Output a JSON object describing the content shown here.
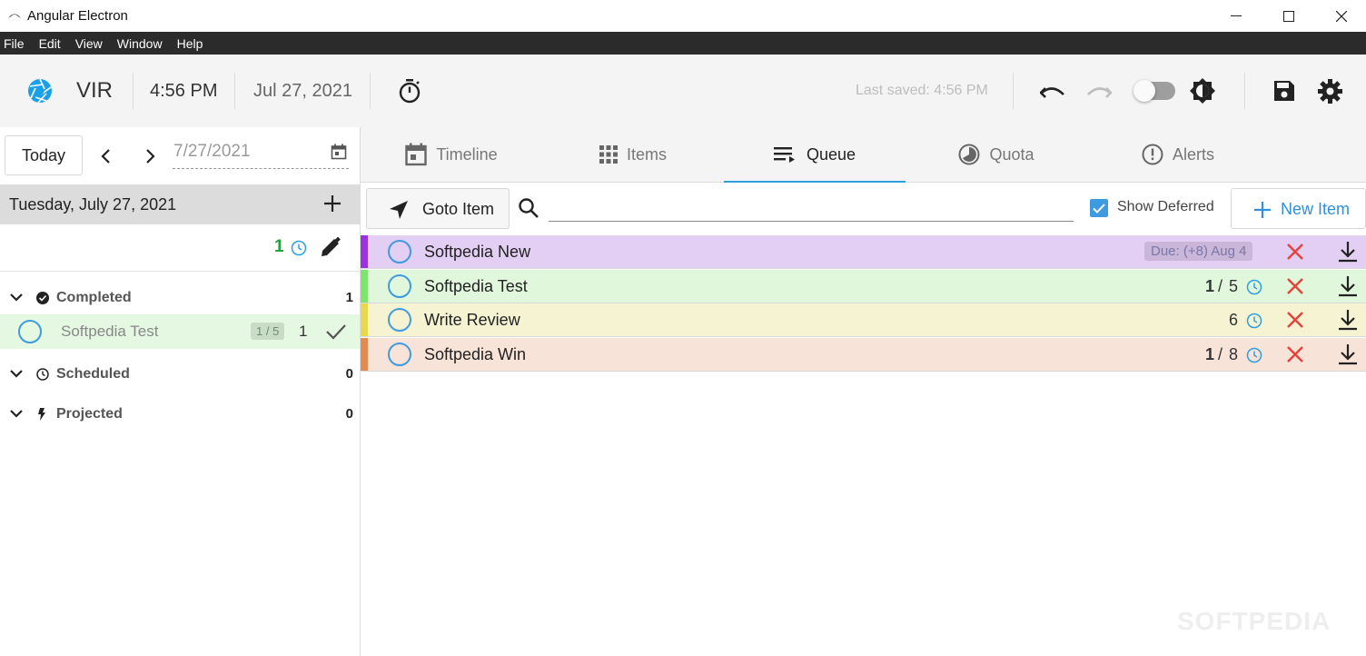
{
  "window": {
    "title": "Angular Electron"
  },
  "menu": [
    "File",
    "Edit",
    "View",
    "Window",
    "Help"
  ],
  "toolbar": {
    "brand": "VIR",
    "time": "4:56 PM",
    "date": "Jul 27, 2021",
    "last_saved": "Last saved: 4:56 PM"
  },
  "left": {
    "today_label": "Today",
    "date_value": "7/27/2021",
    "day_header": "Tuesday, July 27, 2021",
    "day_count": "1",
    "sections": {
      "completed": {
        "label": "Completed",
        "count": "1"
      },
      "scheduled": {
        "label": "Scheduled",
        "count": "0"
      },
      "projected": {
        "label": "Projected",
        "count": "0"
      }
    },
    "completed_item": {
      "name": "Softpedia Test",
      "badge": "1 / 5",
      "count": "1"
    }
  },
  "tabs": [
    {
      "label": "Timeline"
    },
    {
      "label": "Items"
    },
    {
      "label": "Queue",
      "active": true
    },
    {
      "label": "Quota"
    },
    {
      "label": "Alerts"
    }
  ],
  "queue": {
    "goto_label": "Goto Item",
    "search_placeholder": "",
    "show_deferred_label": "Show Deferred",
    "show_deferred": true,
    "new_item_label": "New Item",
    "rows": [
      {
        "name": "Softpedia New",
        "due": "Due: (+8) Aug 4",
        "color": "#e3cff3",
        "stripe": "#9933dd"
      },
      {
        "name": "Softpedia Test",
        "done": "1",
        "sep": "/",
        "total": "5",
        "color": "#e0f7dc",
        "stripe": "#7ee36f"
      },
      {
        "name": "Write Review",
        "total": "6",
        "color": "#f6f3d3",
        "stripe": "#e8d84b"
      },
      {
        "name": "Softpedia Win",
        "done": "1",
        "sep": "/",
        "total": "8",
        "color": "#f8e3d8",
        "stripe": "#e58a4f"
      }
    ]
  },
  "watermark": "SOFTPEDIA"
}
